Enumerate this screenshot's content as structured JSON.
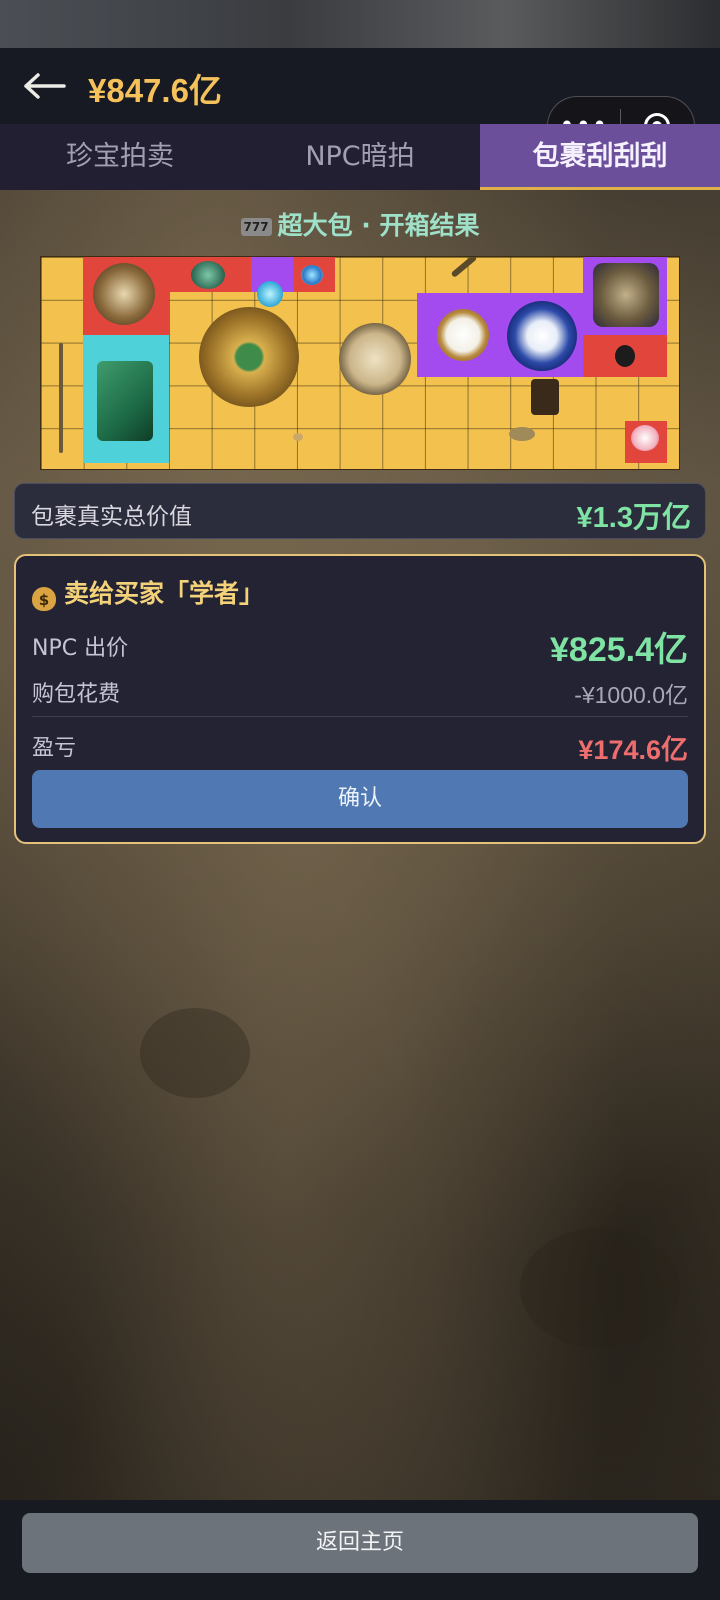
{
  "header": {
    "back_icon": "arrow-left-icon",
    "balance": "¥847.6亿"
  },
  "capsule": {
    "more_icon": "ellipsis-icon",
    "more_label": "•••",
    "close_icon": "target-icon"
  },
  "tabs": [
    {
      "label": "珍宝拍卖"
    },
    {
      "label": "NPC暗拍"
    },
    {
      "label": "包裹刮刮刮"
    }
  ],
  "result": {
    "icon_label": "777",
    "title": "超大包 · 开箱结果"
  },
  "package_value": {
    "label": "包裹真实总价值",
    "value": "¥1.3万亿"
  },
  "sell": {
    "title": "卖给买家「学者」",
    "npc_offer_label": "NPC 出价",
    "npc_offer_value": "¥825.4亿",
    "cost_label": "购包花费",
    "cost_value": "-¥1000.0亿",
    "profit_label": "盈亏",
    "profit_value": "¥174.6亿",
    "confirm_label": "确认"
  },
  "footer": {
    "home_label": "返回主页"
  },
  "colors": {
    "accent_gold": "#f5c15a",
    "tab_active": "#6b4f9a",
    "positive": "#7fe3a3",
    "negative": "#ee6e6e",
    "confirm": "#5079b3"
  }
}
